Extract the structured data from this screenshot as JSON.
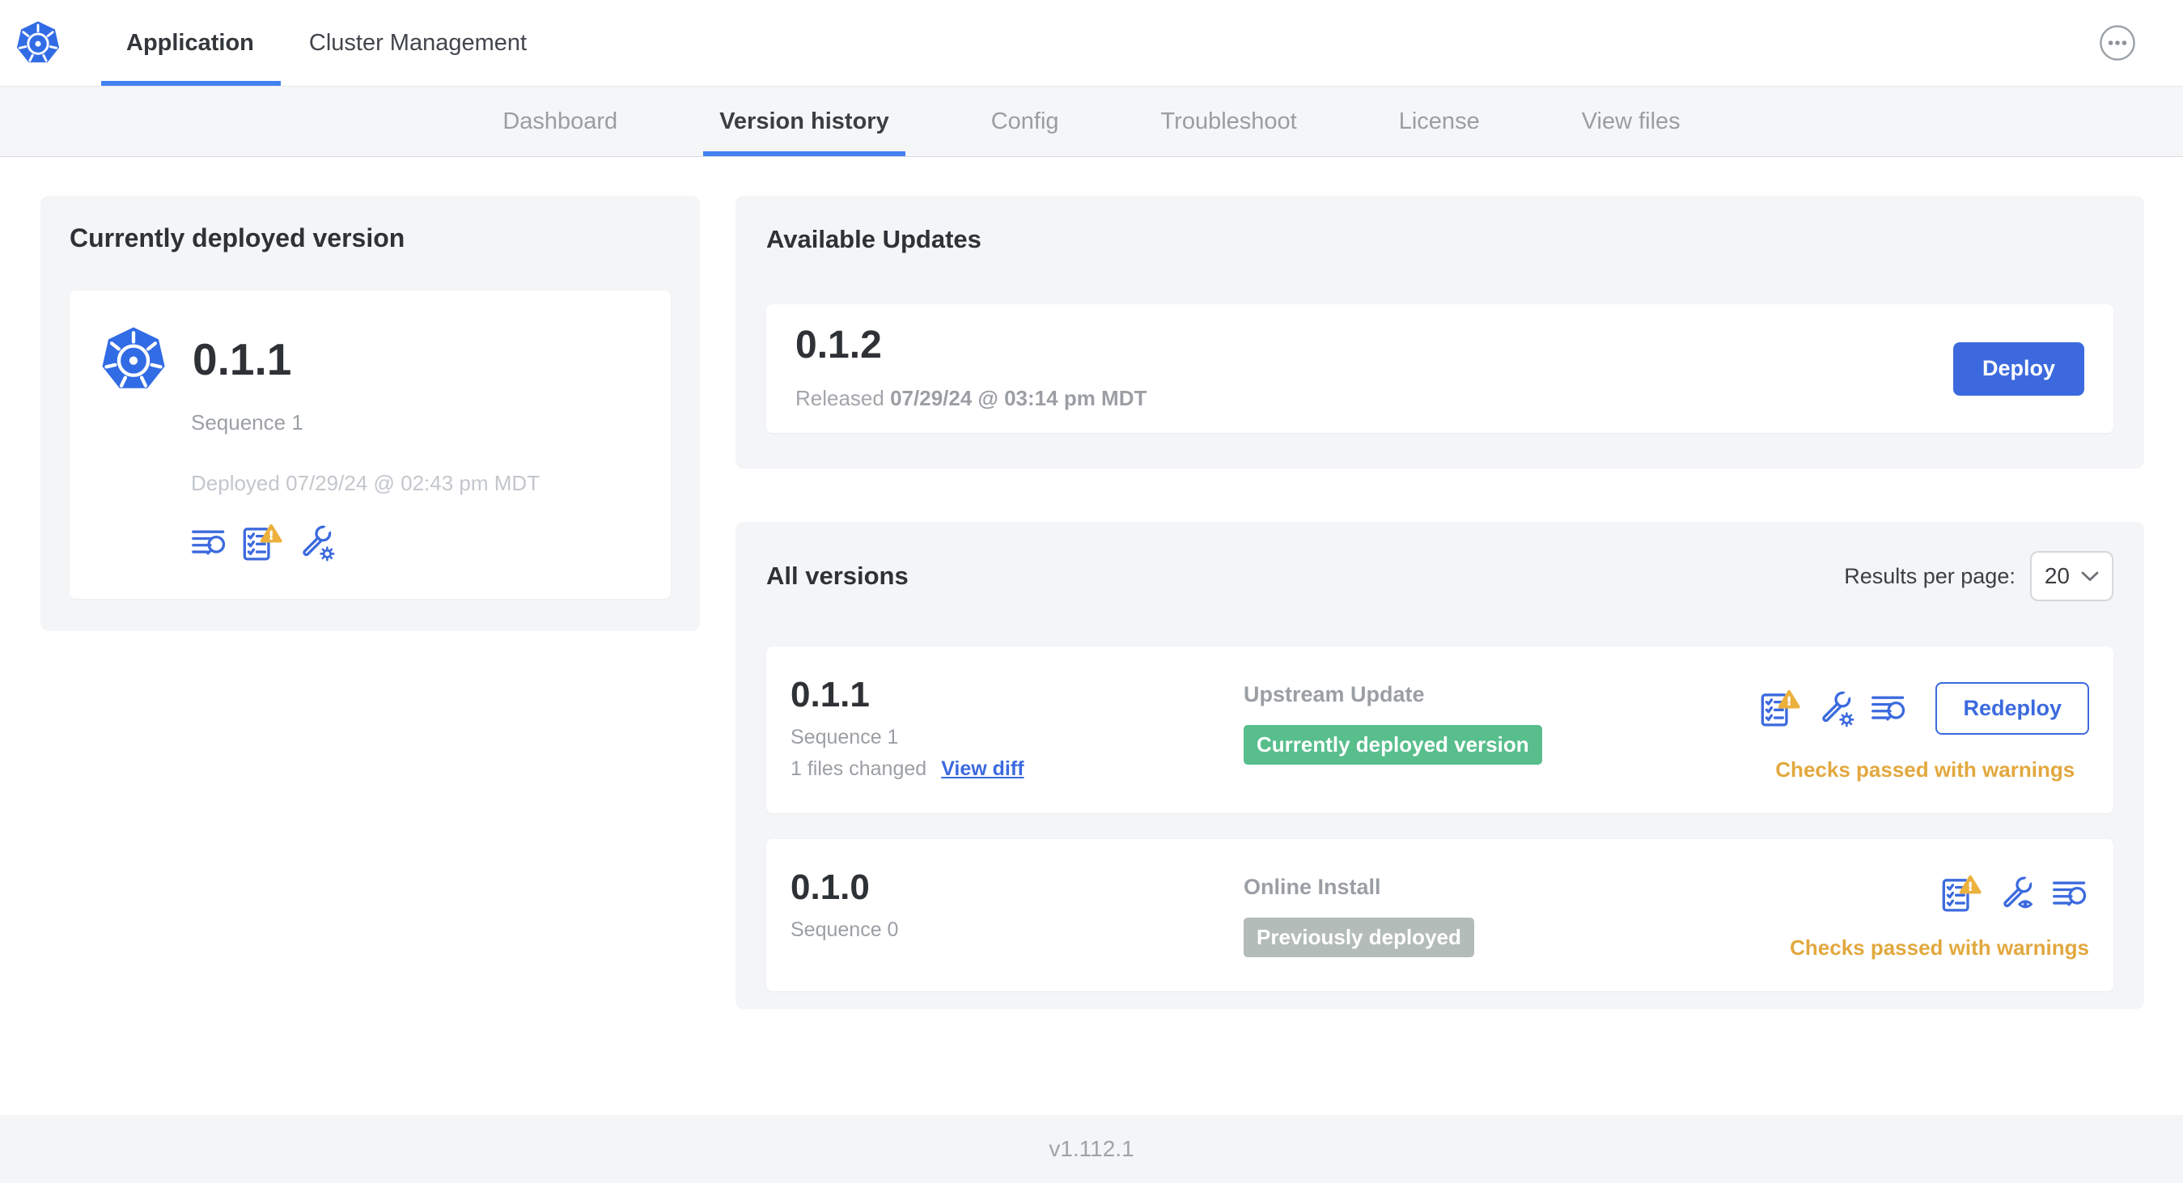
{
  "header": {
    "app_tabs": [
      {
        "label": "Application",
        "active": true
      },
      {
        "label": "Cluster Management",
        "active": false
      }
    ]
  },
  "subnav": {
    "items": [
      {
        "label": "Dashboard",
        "active": false
      },
      {
        "label": "Version history",
        "active": true
      },
      {
        "label": "Config",
        "active": false
      },
      {
        "label": "Troubleshoot",
        "active": false
      },
      {
        "label": "License",
        "active": false
      },
      {
        "label": "View files",
        "active": false
      }
    ]
  },
  "current_version": {
    "title": "Currently deployed version",
    "version": "0.1.1",
    "sequence": "Sequence 1",
    "deployed": "Deployed 07/29/24 @ 02:43 pm MDT",
    "icons": [
      "logs-icon",
      "preflight-checks-warning-icon",
      "config-gear-icon"
    ]
  },
  "available_updates": {
    "title": "Available Updates",
    "version": "0.1.2",
    "released_prefix": "Released",
    "released_date": "07/29/24 @ 03:14 pm MDT",
    "deploy_label": "Deploy"
  },
  "all_versions": {
    "title": "All versions",
    "results_per_page_label": "Results per page:",
    "results_per_page_value": "20",
    "rows": [
      {
        "version": "0.1.1",
        "sequence": "Sequence 1",
        "files_changed": "1 files changed",
        "view_diff_label": "View diff",
        "source": "Upstream Update",
        "status_label": "Currently deployed version",
        "status_color": "green",
        "icons": [
          "preflight-checks-warning-icon",
          "config-gear-icon",
          "logs-icon"
        ],
        "action_label": "Redeploy",
        "checks": "Checks passed with warnings"
      },
      {
        "version": "0.1.0",
        "sequence": "Sequence 0",
        "source": "Online Install",
        "status_label": "Previously deployed",
        "status_color": "gray",
        "icons": [
          "preflight-checks-warning-icon",
          "config-view-icon",
          "logs-icon"
        ],
        "checks": "Checks passed with warnings"
      }
    ]
  },
  "footer": {
    "version": "v1.112.1"
  },
  "colors": {
    "accent_blue": "#3c6ade",
    "tab_underline_blue": "#4282f2",
    "kubernetes_blue": "#326ce5",
    "badge_green": "#57be8c",
    "badge_gray": "#b4bcba",
    "warning_amber": "#e2a83e",
    "panel_gray": "#f4f5f7"
  }
}
